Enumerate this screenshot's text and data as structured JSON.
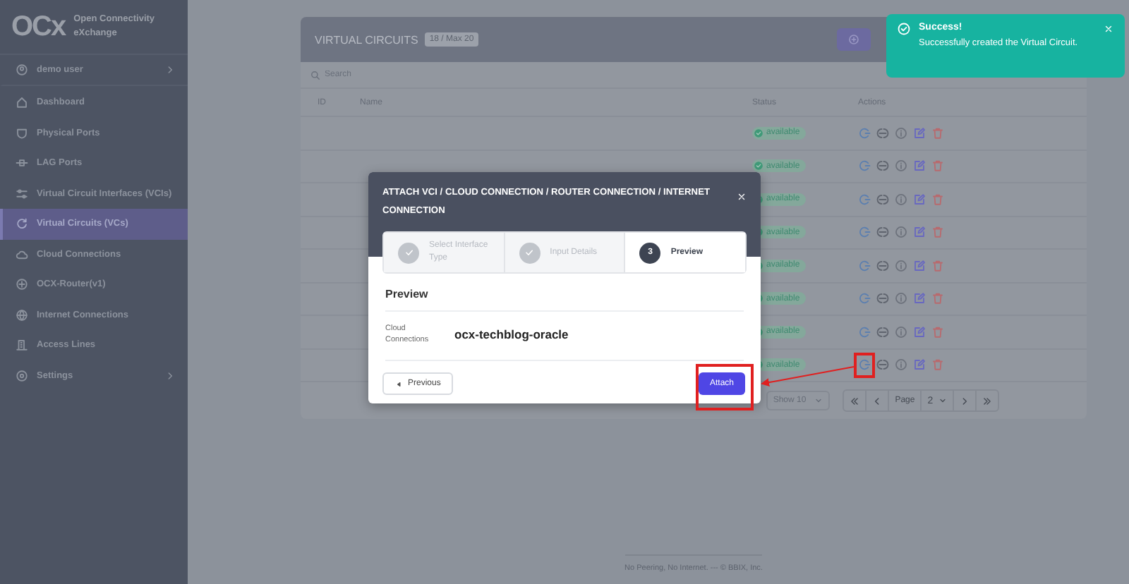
{
  "sidebar": {
    "logo": {
      "mark": "OCx",
      "line_1": "Open Connectivity",
      "line_2": "eXchange"
    },
    "user": {
      "label": "demo user",
      "expandable": true
    },
    "items": [
      {
        "label": "Dashboard",
        "selected": false,
        "expandable": false
      },
      {
        "label": "Physical Ports",
        "selected": false,
        "expandable": false
      },
      {
        "label": "LAG Ports",
        "selected": false,
        "expandable": false
      },
      {
        "label": "Virtual Circuit Interfaces (VCIs)",
        "selected": false,
        "expandable": false
      },
      {
        "label": "Virtual Circuits (VCs)",
        "selected": true,
        "expandable": false
      },
      {
        "label": "Cloud Connections",
        "selected": false,
        "expandable": false
      },
      {
        "label": "OCX-Router(v1)",
        "selected": false,
        "expandable": false
      },
      {
        "label": "Internet Connections",
        "selected": false,
        "expandable": false
      },
      {
        "label": "Access Lines",
        "selected": false,
        "expandable": false
      },
      {
        "label": "Settings",
        "selected": false,
        "expandable": true
      }
    ]
  },
  "card": {
    "title": "VIRTUAL CIRCUITS",
    "badge": "18 / Max 20",
    "search": {
      "placeholder": "Search"
    },
    "columns": [
      "ID",
      "Name",
      "Status",
      "Actions"
    ],
    "rows": [
      {
        "status": "available"
      },
      {
        "status": "available"
      },
      {
        "status": "available"
      },
      {
        "status": "available"
      },
      {
        "status": "available"
      },
      {
        "status": "available"
      },
      {
        "status": "available"
      },
      {
        "status": "available"
      }
    ],
    "pagination": {
      "page_size": "Show 10",
      "page_label": "Page",
      "page": "2"
    }
  },
  "footer": "No Peering, No Internet. --- © BBIX, Inc.",
  "modal": {
    "title": "ATTACH VCI / CLOUD CONNECTION / ROUTER CONNECTION / INTERNET CONNECTION",
    "steps": [
      {
        "label": "Select Interface Type",
        "completed": true,
        "selected": false
      },
      {
        "label": "Input Details",
        "completed": true,
        "selected": false
      },
      {
        "label": "Preview",
        "number": "3",
        "completed": false,
        "selected": true
      }
    ],
    "section": "Preview",
    "fields": [
      {
        "label": "Cloud Connections",
        "value": "ocx-techblog-oracle"
      }
    ],
    "buttons": {
      "previous": "Previous",
      "attach": "Attach"
    }
  },
  "toast": {
    "title": "Success!",
    "message": "Successfully created the Virtual Circuit."
  }
}
